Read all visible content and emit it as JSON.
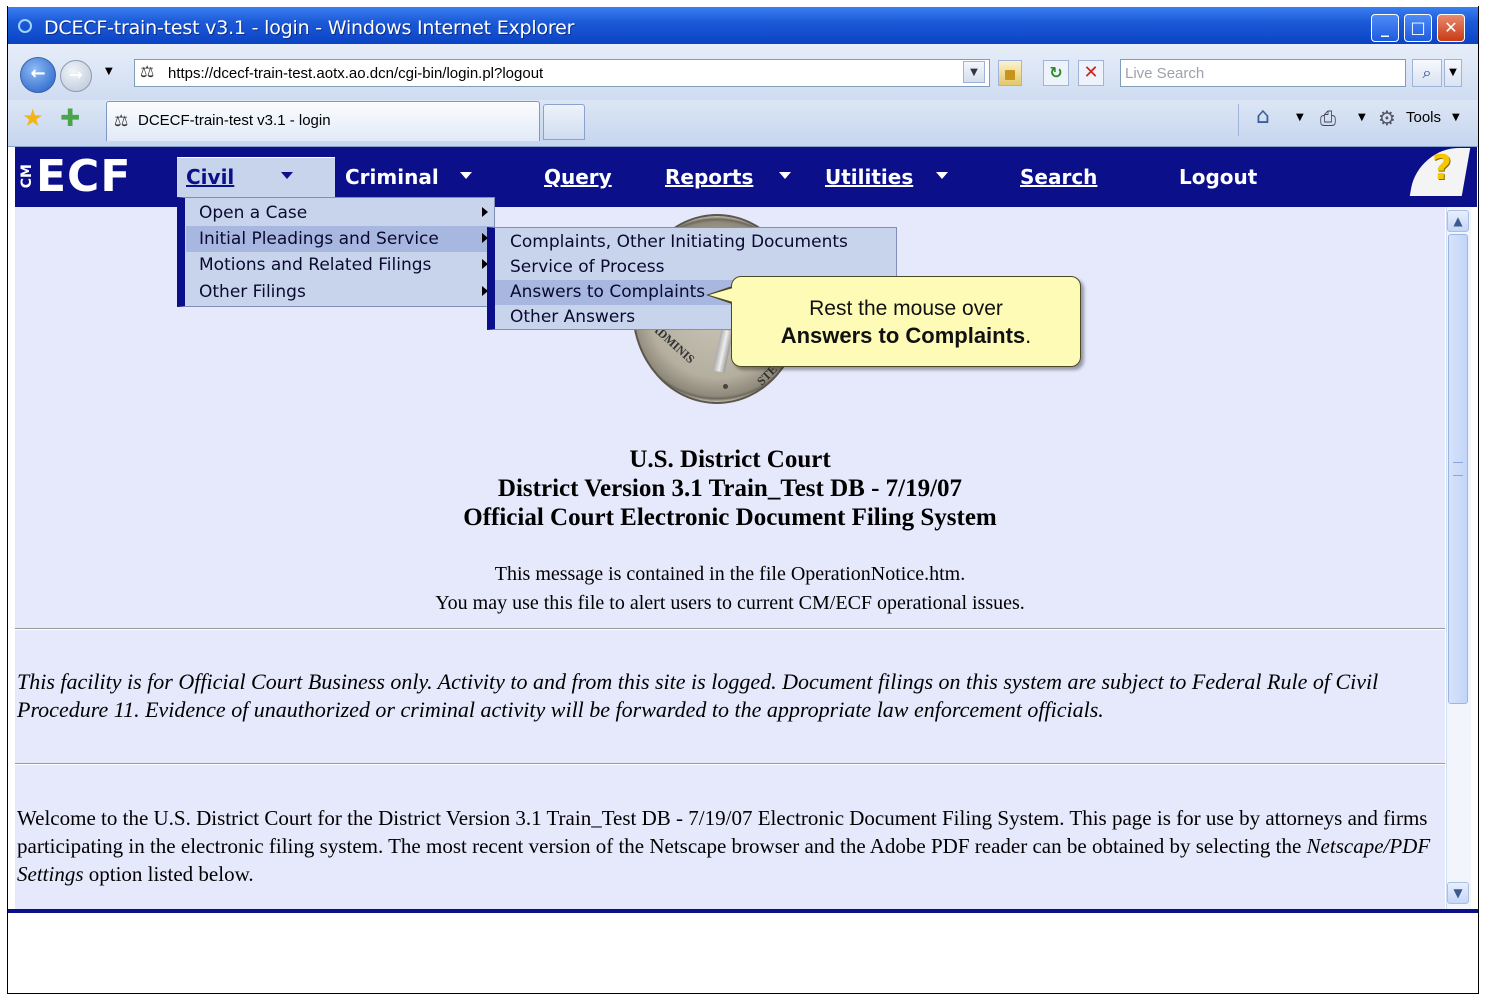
{
  "window": {
    "title": "DCECF-train-test v3.1 - login - Windows Internet Explorer"
  },
  "address_bar": {
    "url": "https://dcecf-train-test.aotx.ao.dcn/cgi-bin/login.pl?logout",
    "search_placeholder": "Live Search"
  },
  "tabs": [
    {
      "label": "DCECF-train-test v3.1 - login",
      "active": true
    }
  ],
  "command_bar": {
    "tools_label": "Tools"
  },
  "ecf_menu": {
    "logo": "ECF",
    "logo_prefix": "CM",
    "items": [
      {
        "label": "Civil",
        "has_dropdown": true,
        "active": true
      },
      {
        "label": "Criminal",
        "has_dropdown": true
      },
      {
        "label": "Query",
        "has_dropdown": false
      },
      {
        "label": "Reports",
        "has_dropdown": true
      },
      {
        "label": "Utilities",
        "has_dropdown": true
      },
      {
        "label": "Search",
        "has_dropdown": false
      },
      {
        "label": "Logout",
        "has_dropdown": false
      }
    ],
    "help_icon": "?"
  },
  "civil_menu": {
    "items": [
      "Open a Case",
      "Initial Pleadings and Service",
      "Motions and Related Filings",
      "Other Filings"
    ],
    "highlighted": "Initial Pleadings and Service"
  },
  "submenu": {
    "items": [
      "Complaints, Other Initiating Documents",
      "Service of Process",
      "Answers to Complaints",
      "Other Answers"
    ],
    "highlighted": "Answers to Complaints"
  },
  "callout": {
    "line1": "Rest the mouse over",
    "line2_bold": "Answers to Complaints",
    "line2_suffix": "."
  },
  "page": {
    "title_line1": "U.S. District Court",
    "title_line2": "District Version 3.1 Train_Test DB - 7/19/07",
    "title_line3": "Official Court Electronic Document Filing System",
    "notice_line1": "This message is contained in the file OperationNotice.htm.",
    "notice_line2": "You may use this file to alert users to current CM/ECF operational issues.",
    "warning": "This facility is for Official Court Business only. Activity to and from this site is logged. Document filings on this system are subject to Federal Rule of Civil Procedure 11. Evidence of unauthorized or criminal activity will be forwarded to the appropriate law enforcement officials.",
    "welcome_part1": "Welcome to the U.S. District Court for the District Version 3.1 Train_Test DB - 7/19/07 Electronic Document Filing System. This page is for use by attorneys and firms participating in the electronic filing system. The most recent version of the Netscape browser and the Adobe PDF reader can be obtained by selecting the ",
    "welcome_italic": "Netscape/PDF Settings",
    "welcome_part2": " option listed below.",
    "seal_text_left": "ADMINIS",
    "seal_text_right": "STE"
  },
  "colors": {
    "menubar": "#0b0f8a",
    "content_bg": "#e6e8fb",
    "menu_bg": "#c8d3ec",
    "menu_highlight": "#a8b7e0",
    "callout_bg": "#fdfbb6"
  }
}
